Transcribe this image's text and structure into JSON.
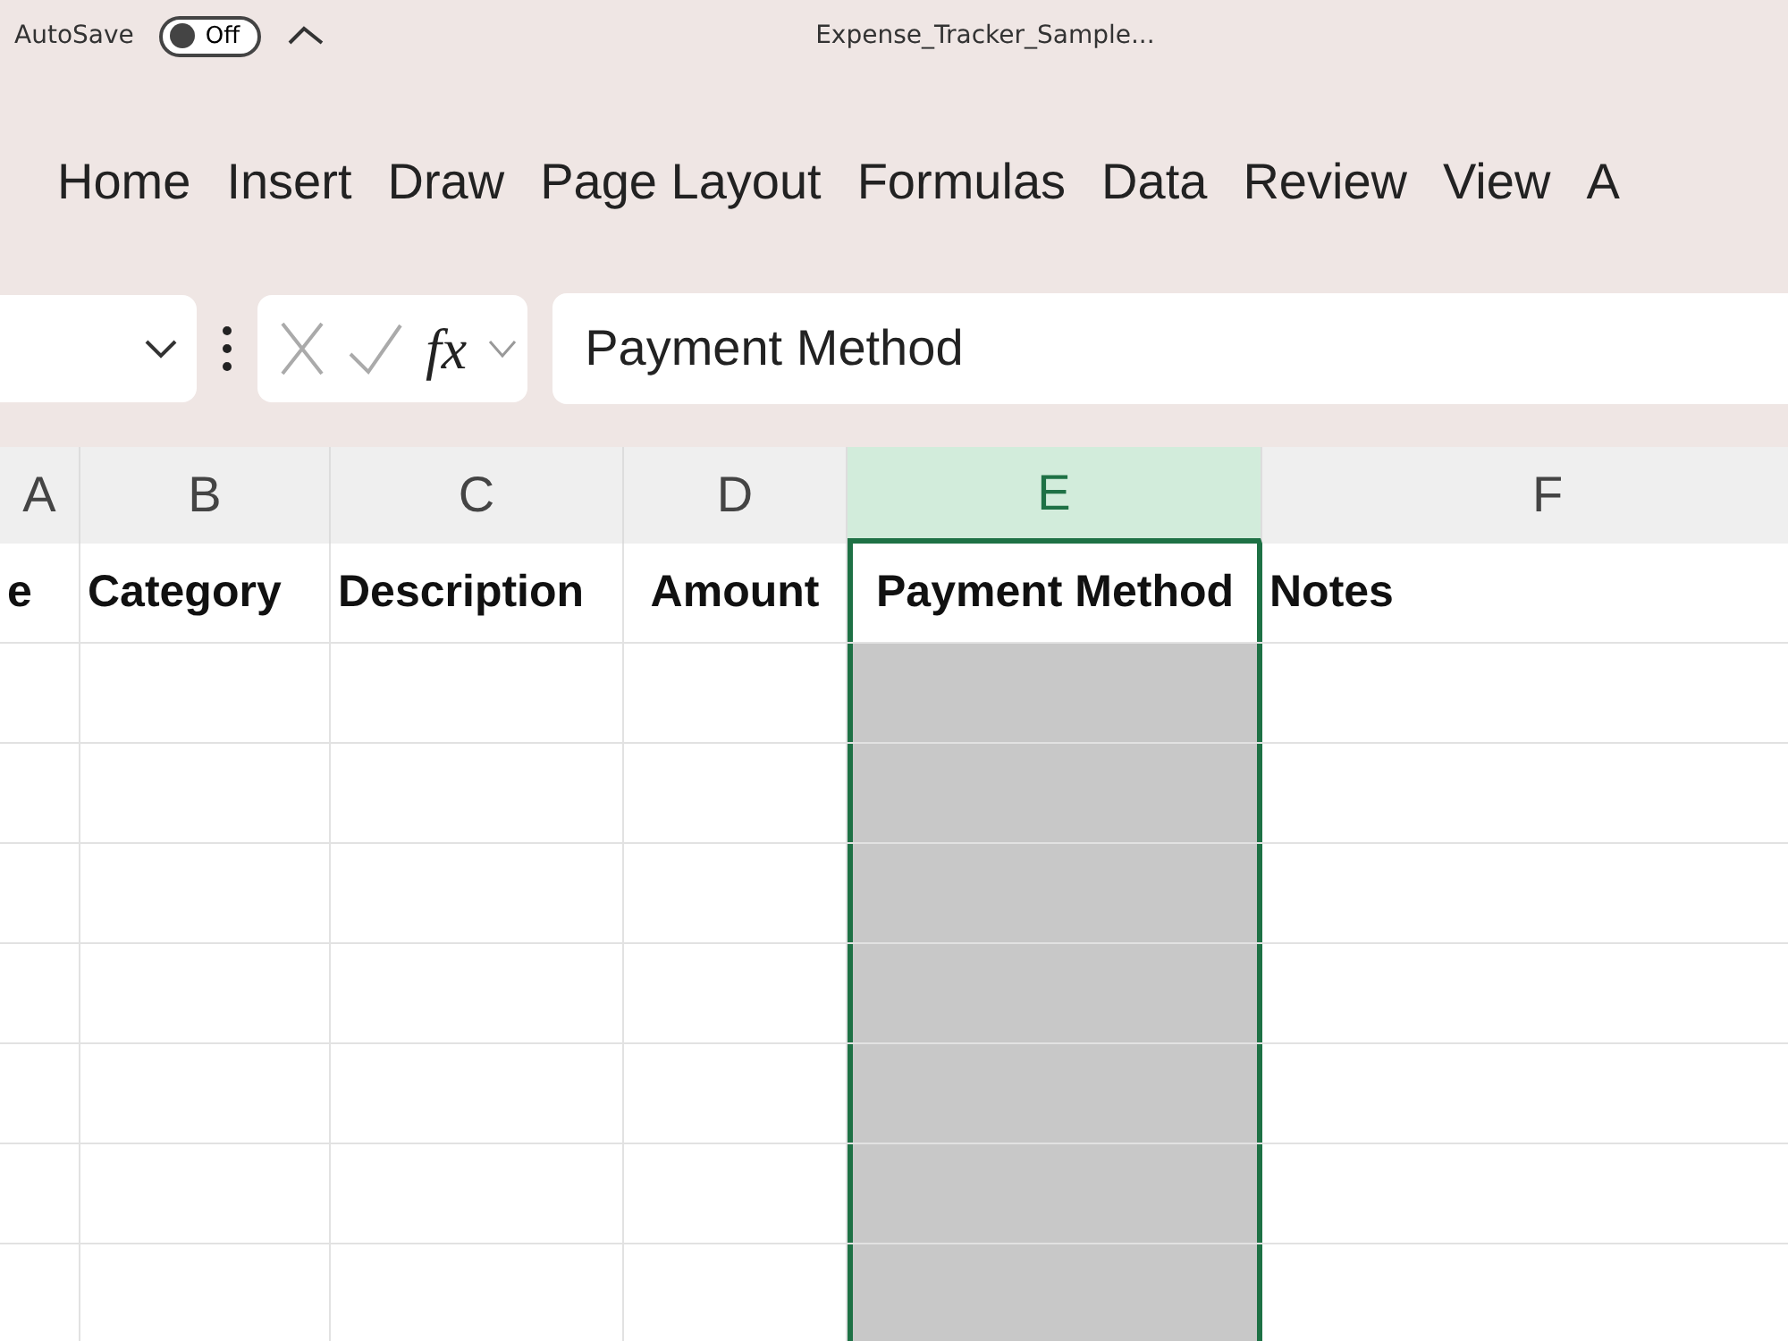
{
  "title_bar": {
    "autosave_label": "AutoSave",
    "autosave_on": false,
    "toggle_text": "Off",
    "file_name": "Expense_Tracker_Sample..."
  },
  "ribbon_tabs": [
    {
      "label": "Home",
      "selected": false
    },
    {
      "label": "Insert",
      "selected": false
    },
    {
      "label": "Draw",
      "selected": false
    },
    {
      "label": "Page Layout",
      "selected": false
    },
    {
      "label": "Formulas",
      "selected": false
    },
    {
      "label": "Data",
      "selected": false
    },
    {
      "label": "Review",
      "selected": false
    },
    {
      "label": "View",
      "selected": false
    },
    {
      "label": "A",
      "selected": false
    }
  ],
  "formula_bar": {
    "fx": "fx",
    "value": "Payment Method"
  },
  "columns": [
    {
      "label": "A",
      "selected": false
    },
    {
      "label": "B",
      "selected": false
    },
    {
      "label": "C",
      "selected": false
    },
    {
      "label": "D",
      "selected": false
    },
    {
      "label": "E",
      "selected": true
    },
    {
      "label": "F",
      "selected": false
    }
  ],
  "header_row": [
    "e",
    "Category",
    "Description",
    "Amount",
    "Payment Method",
    "Notes"
  ]
}
